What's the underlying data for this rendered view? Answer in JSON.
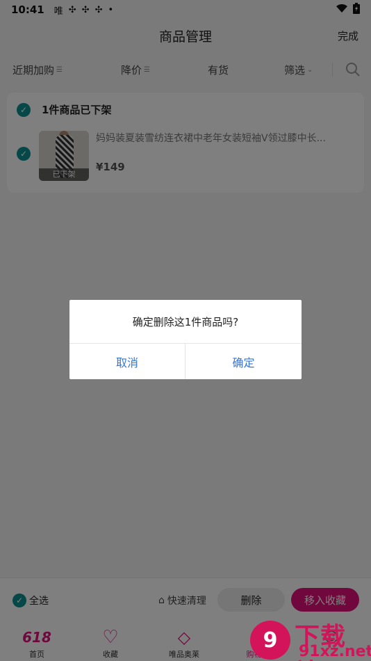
{
  "status": {
    "time": "10:41",
    "carrier": "唯"
  },
  "nav": {
    "title": "商品管理",
    "done": "完成"
  },
  "filters": {
    "recent": "近期加购",
    "price_drop": "降价",
    "in_stock": "有货",
    "filter": "筛选"
  },
  "card": {
    "header": "1件商品已下架",
    "item": {
      "name": "妈妈装夏装雪纺连衣裙中老年女装短袖V领过膝中长...",
      "price": "¥149",
      "status": "已下架"
    }
  },
  "bottom": {
    "select_all": "全选",
    "quick_clean": "快速清理",
    "delete": "删除",
    "move_fav": "移入收藏"
  },
  "tabs": [
    {
      "label": "首页",
      "icon": "618-icon",
      "glyph": "618"
    },
    {
      "label": "收藏",
      "icon": "heart-icon",
      "glyph": "♡"
    },
    {
      "label": "唯品奥莱",
      "icon": "tag-icon",
      "glyph": "◇"
    },
    {
      "label": "购物车",
      "icon": "cart-icon",
      "glyph": "●"
    },
    {
      "label": "",
      "icon": "profile-icon",
      "glyph": "☺"
    }
  ],
  "dialog": {
    "message": "确定删除这1件商品吗?",
    "cancel": "取消",
    "confirm": "确定"
  },
  "watermark": {
    "top": "下载站",
    "bottom": "91xz.net",
    "badge": "9"
  },
  "colors": {
    "accent": "#e0107a",
    "check": "#0d8f8f",
    "dialog_button": "#3575d6"
  }
}
